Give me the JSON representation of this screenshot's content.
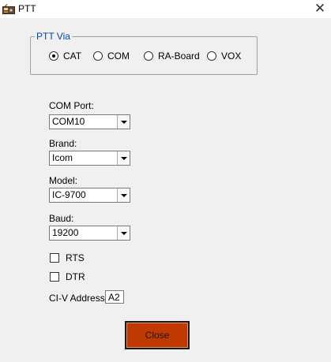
{
  "window": {
    "title": "PTT",
    "icon": "radio-device-icon",
    "close_glyph": "✕"
  },
  "ptt_via": {
    "legend": "PTT Via",
    "options": [
      {
        "label": "CAT",
        "checked": true
      },
      {
        "label": "COM",
        "checked": false
      },
      {
        "label": "RA-Board",
        "checked": false
      },
      {
        "label": "VOX",
        "checked": false
      }
    ]
  },
  "com_port": {
    "label": "COM Port:",
    "value": "COM10"
  },
  "brand": {
    "label": "Brand:",
    "value": "Icom"
  },
  "model": {
    "label": "Model:",
    "value": "IC-9700"
  },
  "baud": {
    "label": "Baud:",
    "value": "19200"
  },
  "rts": {
    "label": "RTS",
    "checked": false
  },
  "dtr": {
    "label": "DTR",
    "checked": false
  },
  "civ": {
    "label": "CI-V Address:",
    "value": "A2"
  },
  "close_button": {
    "label": "Close"
  },
  "colors": {
    "legend": "#0047ab",
    "close_button_bg": "#bf3900",
    "window_bg": "#f0f0f0"
  }
}
